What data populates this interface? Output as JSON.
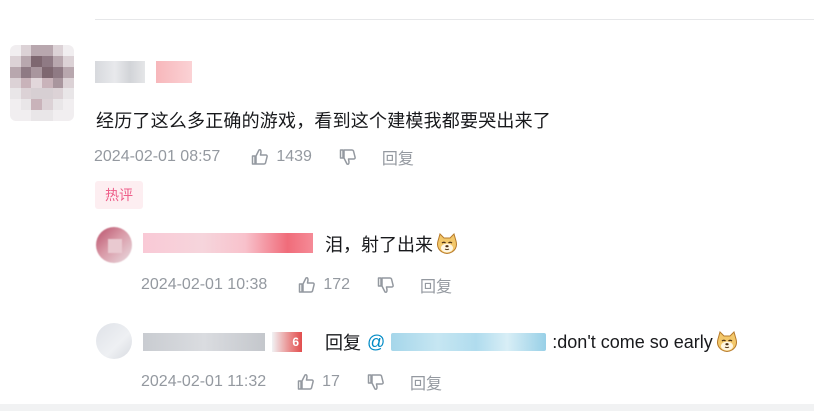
{
  "main_comment": {
    "text": "经历了这么多正确的游戏，看到这个建模我都要哭出来了",
    "timestamp": "2024-02-01 08:57",
    "like_count": "1439",
    "reply_label": "回复",
    "hot_tag": "热评"
  },
  "replies": [
    {
      "text": "泪，射了出来",
      "emoji": "doge-emoji",
      "timestamp": "2024-02-01 10:38",
      "like_count": "172",
      "reply_label": "回复"
    },
    {
      "reply_prefix": "回复",
      "mention_at": "@",
      "text": ":don't come so early",
      "emoji": "doge-emoji",
      "timestamp": "2024-02-01 11:32",
      "like_count": "17",
      "reply_label": "回复",
      "level_badge": "6"
    }
  ],
  "colors": {
    "meta_text": "#9499a0",
    "hot_tag_bg": "#fdeef1",
    "hot_tag_text": "#ee5f8a",
    "mention": "#008ac5"
  }
}
